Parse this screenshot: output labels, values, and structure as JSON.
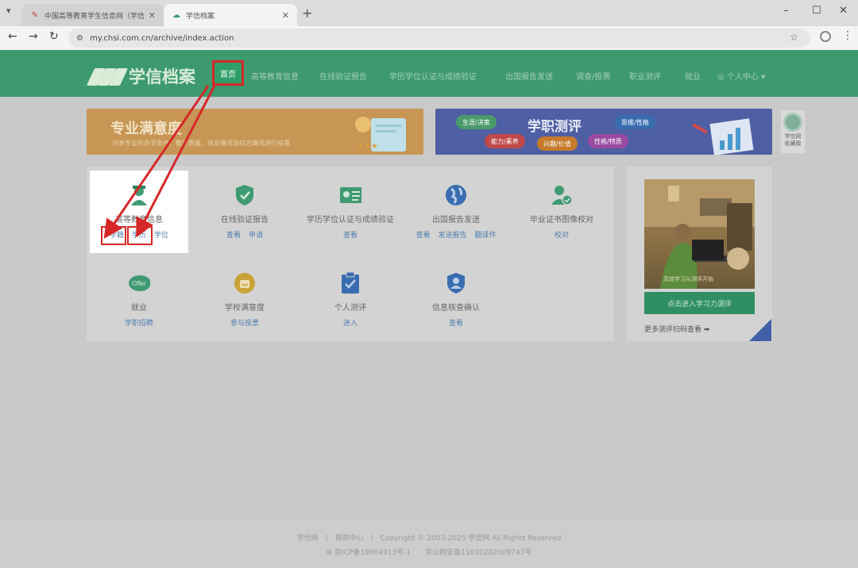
{
  "browser": {
    "tabs": [
      {
        "title": "中国高等教育学生信息网（学信..."
      },
      {
        "title": "学信档案"
      }
    ],
    "url": "my.chsi.com.cn/archive/index.action"
  },
  "site": {
    "logo_text": "学信档案",
    "nav": {
      "home": "首页",
      "items": [
        "高等教育信息",
        "在线验证报告",
        "学历学位认证与成绩验证",
        "出国报告发送",
        "调查/投票",
        "职业测评",
        "就业"
      ],
      "user": "个人中心"
    }
  },
  "banners": {
    "left": {
      "title": "专业满意度",
      "subtitle": "对本专业的办学条件、教学质量、就业情况及综合情况进行投票"
    },
    "right": {
      "title": "学职测评",
      "pills": [
        "生涯/决策",
        "能力/素养",
        "兴趣/价值",
        "性格/特质",
        "思维/性格"
      ]
    },
    "side_label": "学信网 收藏我"
  },
  "services": [
    {
      "name": "高等教育信息",
      "links": [
        "学籍",
        "学历",
        "学位"
      ],
      "icon": "graduate-icon"
    },
    {
      "name": "在线验证报告",
      "links": [
        "查看",
        "申请"
      ],
      "icon": "shield-check-icon"
    },
    {
      "name": "学历学位认证与成绩验证",
      "links": [
        "查看"
      ],
      "icon": "id-card-icon"
    },
    {
      "name": "出国报告发送",
      "links": [
        "查看",
        "发送报告",
        "翻译件"
      ],
      "icon": "globe-icon"
    },
    {
      "name": "毕业证书图像校对",
      "links": [
        "校对"
      ],
      "icon": "user-check-icon"
    },
    {
      "name": "就业",
      "links": [
        "学职招聘"
      ],
      "icon": "offer-icon"
    },
    {
      "name": "学校满意度",
      "links": [
        "参与投票"
      ],
      "icon": "smile-icon"
    },
    {
      "name": "个人测评",
      "links": [
        "进入"
      ],
      "icon": "clipboard-icon"
    },
    {
      "name": "信息核查确认",
      "links": [
        "查看"
      ],
      "icon": "user-shield-icon"
    }
  ],
  "right_card": {
    "cta": "点击进入学习力测评",
    "more": "更多测评扫码查看 ➡"
  },
  "footer": {
    "line1": "学信网　|　帮助中心　|　Copyright © 2003-2025 学信网 All Rights Reserved",
    "line2": "京ICP备19004913号-1　　京公网安备11010202009747号"
  },
  "colors": {
    "header_green": "#3d9a6e",
    "annotation_red": "#d62828",
    "link_blue": "#4f7fb0"
  }
}
